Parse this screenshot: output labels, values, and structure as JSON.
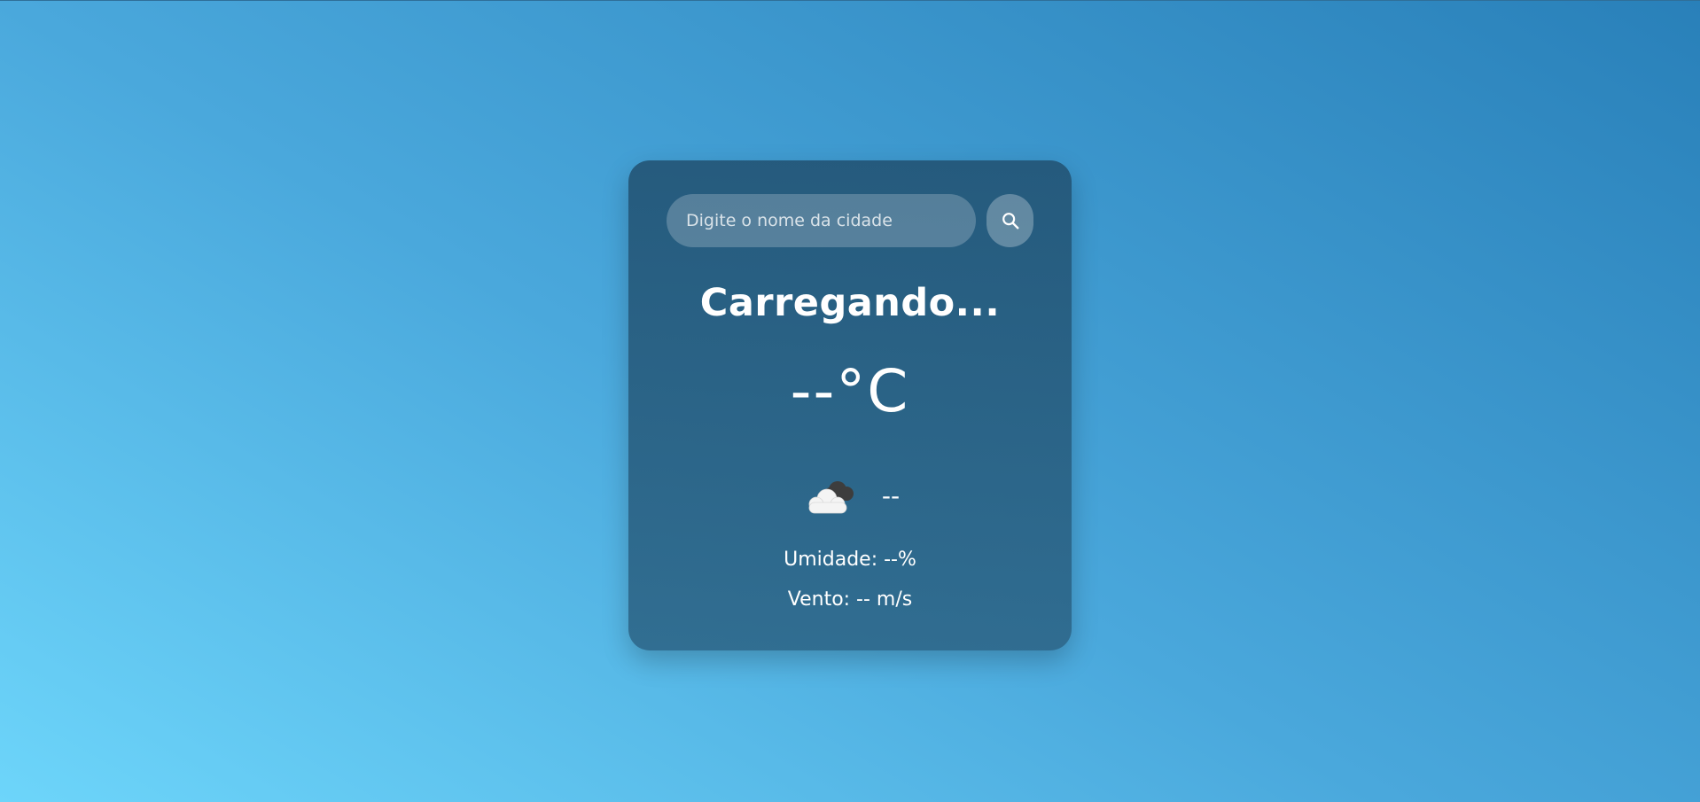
{
  "search": {
    "placeholder": "Digite o nome da cidade",
    "value": "",
    "icon": "search-icon"
  },
  "weather": {
    "city": "Carregando...",
    "temperature": "--°C",
    "icon": "cloud-icon",
    "description": "--",
    "humidity": "Umidade: --%",
    "wind": "Vento: -- m/s"
  },
  "colors": {
    "background_start": "#6dd5fa",
    "background_end": "#2980b9",
    "card": "#2a5f82",
    "text": "#ffffff"
  }
}
